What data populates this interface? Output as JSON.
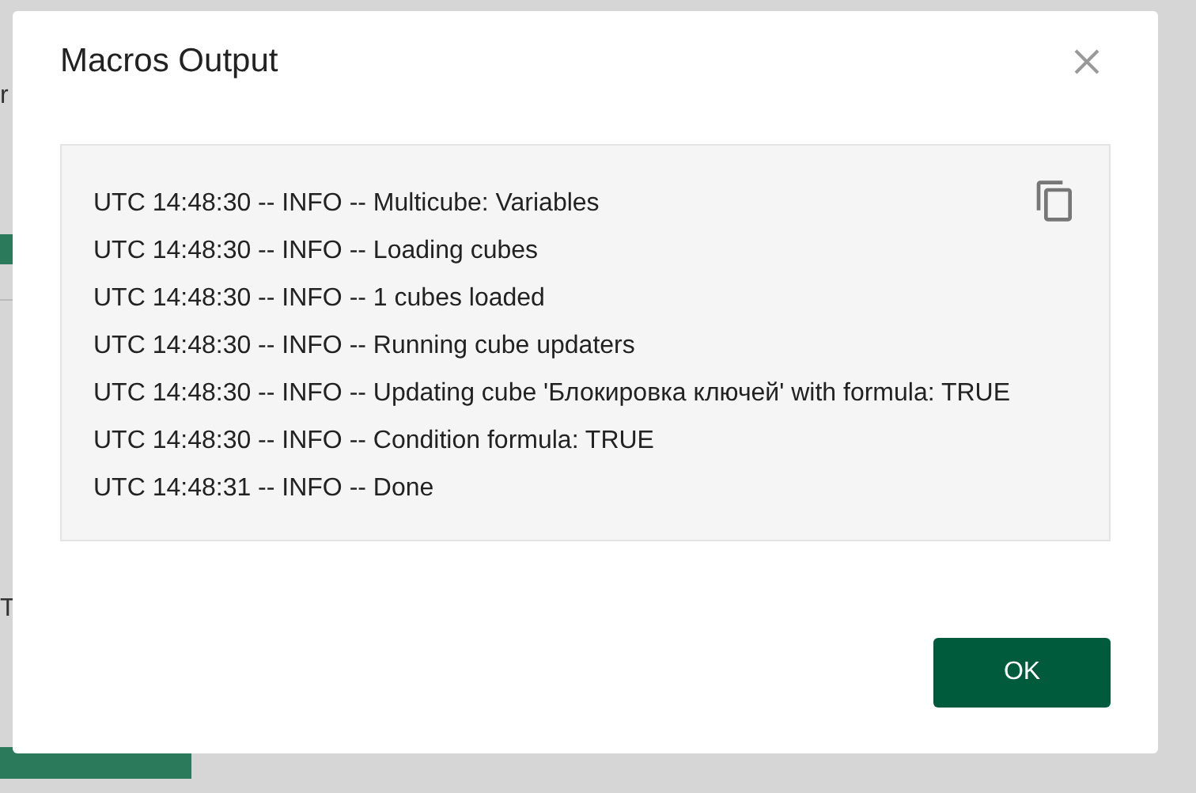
{
  "background": {
    "texts": [
      {
        "text": "r"
      },
      {
        "text": "T"
      }
    ]
  },
  "dialog": {
    "title": "Macros Output",
    "log_lines": [
      "UTC 14:48:30 -- INFO -- Multicube: Variables",
      "UTC 14:48:30 -- INFO -- Loading cubes",
      "UTC 14:48:30 -- INFO -- 1 cubes loaded",
      "UTC 14:48:30 -- INFO -- Running cube updaters",
      "UTC 14:48:30 -- INFO -- Updating cube 'Блокировка ключей' with formula: TRUE",
      "UTC 14:48:30 -- INFO -- Condition formula: TRUE",
      "UTC 14:48:31 -- INFO -- Done"
    ],
    "buttons": [
      "OK"
    ]
  }
}
